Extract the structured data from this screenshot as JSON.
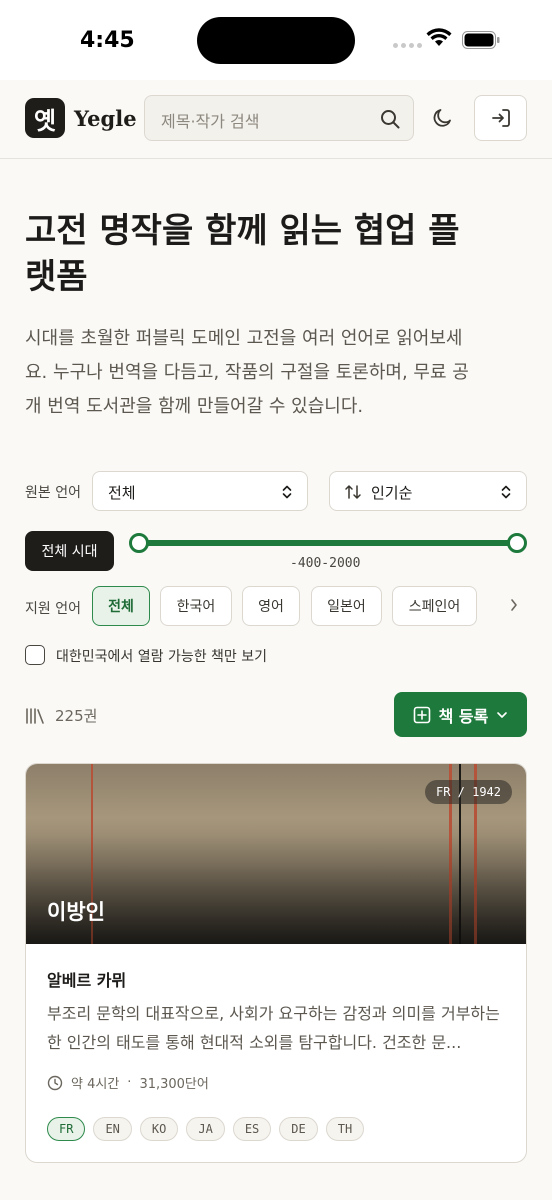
{
  "status_bar": {
    "time": "4:45"
  },
  "header": {
    "app_name": "Yegle",
    "logo_glyph": "옛",
    "search_placeholder": "제목·작가 검색"
  },
  "hero": {
    "title": "고전 명작을 함께 읽는 협업 플랫폼",
    "description": "시대를 초월한 퍼블릭 도메인 고전을 여러 언어로 읽어보세요. 누구나 번역을 다듬고, 작품의 구절을 토론하며, 무료 공개 번역 도서관을 함께 만들어갈 수 있습니다."
  },
  "filters": {
    "source_language_label": "원본 언어",
    "source_language_value": "전체",
    "sort_value": "인기순",
    "era_button": "전체 시대",
    "era_range": "-400-2000",
    "supported_language_label": "지원 언어",
    "language_chips": [
      "전체",
      "한국어",
      "영어",
      "일본어",
      "스페인어"
    ],
    "active_chip": "전체",
    "checkbox_label": "대한민국에서 열람 가능한 책만 보기",
    "checkbox_checked": false
  },
  "list": {
    "count": "225권",
    "register_button": "책 등록"
  },
  "book": {
    "badge": "FR / 1942",
    "title": "이방인",
    "author": "알베르 카뮈",
    "description": "부조리 문학의 대표작으로, 사회가 요구하는 감정과 의미를 거부하는 한 인간의 태도를 통해 현대적 소외를 탐구합니다. 건조한 문...",
    "read_time": "약 4시간",
    "word_count": "31,300단어",
    "languages": [
      "FR",
      "EN",
      "KO",
      "JA",
      "ES",
      "DE",
      "TH"
    ],
    "original_language": "FR"
  },
  "colors": {
    "accent": "#1e7a3c",
    "dark": "#1f1d1a",
    "background": "#faf9f6"
  },
  "icons": [
    "wifi-icon",
    "battery-icon",
    "search-icon",
    "moon-icon",
    "login-icon",
    "sort-icon",
    "chevron-updown-icon",
    "chevron-right-icon",
    "library-icon",
    "plus-square-icon",
    "chevron-down-icon",
    "clock-icon"
  ]
}
